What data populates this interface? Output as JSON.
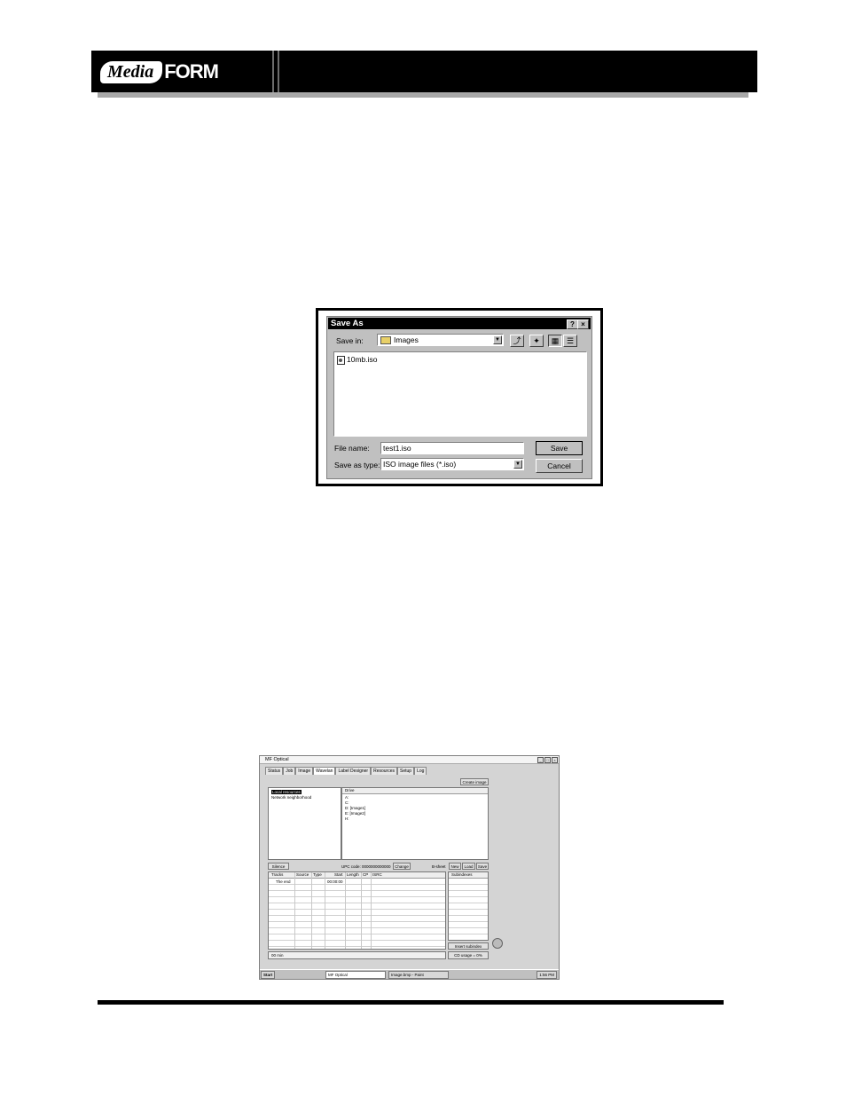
{
  "header": {
    "logo_media": "Media",
    "logo_form": "FORM"
  },
  "save_dialog": {
    "title": "Save As",
    "help_btn": "?",
    "close_btn": "×",
    "save_in_label": "Save in:",
    "save_in_value": "Images",
    "files": [
      "10mb.iso"
    ],
    "file_name_label": "File name:",
    "file_name_value": "test1.iso",
    "save_as_type_label": "Save as type:",
    "save_as_type_value": "ISO image files (*.iso)",
    "save_label": "Save",
    "cancel_label": "Cancel"
  },
  "app_shot": {
    "title": "MF Optical",
    "tabs": [
      "Status",
      "Job",
      "Image",
      "Wavelan",
      "Label Designer",
      "Resources",
      "Setup",
      "Log"
    ],
    "active_tab": 3,
    "create_image_label": "Create image",
    "tree": [
      "Local resources",
      "Network neighborhood"
    ],
    "drive_header": "Drive",
    "drives": [
      "A:",
      "C:",
      "D: [Image1]",
      "E: [Image2]",
      "H:"
    ],
    "silence_label": "Silence",
    "upc_label": "UPC code: 0000000000000",
    "change_label": "Change",
    "cdtext_label": "B-sheet",
    "new_label": "New",
    "load_label": "Load",
    "save_label": "Save",
    "track_headers": [
      "Tracks",
      "Source",
      "Type",
      "Start",
      "Length",
      "CP",
      "ISRC"
    ],
    "track_rows": [
      {
        "name": "The end",
        "start": "00:00:00"
      }
    ],
    "subindex_header": "Subindexes",
    "insert_label": "Insert subindex",
    "size_label": "00 min",
    "usage_label": "CD usage = 0%",
    "taskbar": {
      "start": "Start",
      "app": "MF Optical",
      "paint": "Image.bmp - Paint",
      "clock": "1:56 PM"
    }
  }
}
